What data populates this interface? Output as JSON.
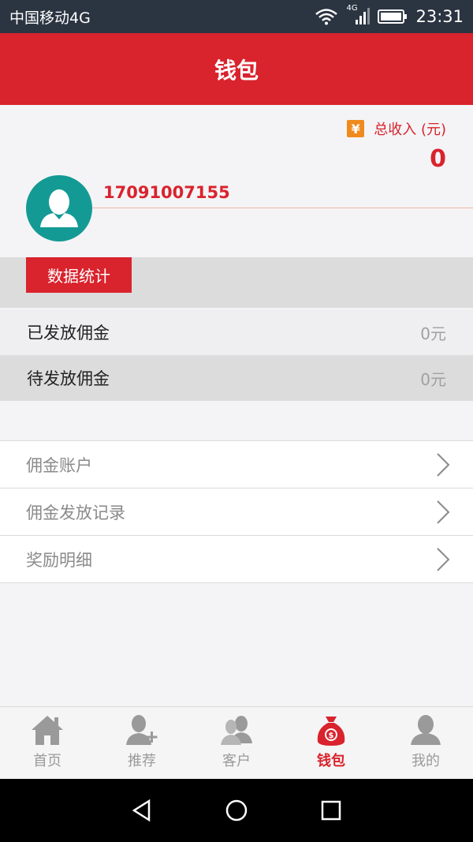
{
  "status_bar": {
    "carrier": "中国移动4G",
    "network_badge": "4G",
    "time": "23:31",
    "icons": [
      "wifi-icon",
      "signal-icon",
      "battery-icon"
    ]
  },
  "header": {
    "title": "钱包"
  },
  "wallet": {
    "income_icon": "¥",
    "income_label": "总收入 (元)",
    "income_value": "0",
    "phone": "17091007155"
  },
  "stats": {
    "tag": "数据统计",
    "rows": [
      {
        "label": "已发放佣金",
        "value": "0元"
      },
      {
        "label": "待发放佣金",
        "value": "0元"
      }
    ]
  },
  "menu": {
    "items": [
      {
        "label": "佣金账户"
      },
      {
        "label": "佣金发放记录"
      },
      {
        "label": "奖励明细"
      }
    ]
  },
  "tabs": {
    "items": [
      {
        "label": "首页",
        "icon": "home-icon"
      },
      {
        "label": "推荐",
        "icon": "add-user-icon"
      },
      {
        "label": "客户",
        "icon": "customers-icon"
      },
      {
        "label": "钱包",
        "icon": "money-bag-icon",
        "active": true
      },
      {
        "label": "我的",
        "icon": "user-icon"
      }
    ]
  },
  "colors": {
    "brand_red": "#d9232d",
    "status_bar": "#2b3441",
    "avatar_teal": "#149a94",
    "yen_orange": "#f08a1c"
  }
}
